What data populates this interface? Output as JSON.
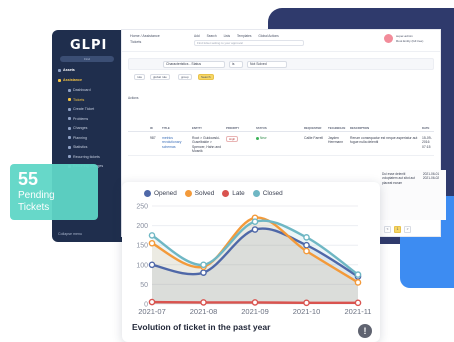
{
  "app": {
    "logo": "GLPI"
  },
  "sidebar": {
    "find_label": "Find",
    "items": [
      {
        "label": "Assets",
        "kind": "top"
      },
      {
        "label": "Assistance",
        "kind": "top",
        "active": true
      },
      {
        "label": "Dashboard",
        "kind": "sub"
      },
      {
        "label": "Tickets",
        "kind": "sub",
        "active": true
      },
      {
        "label": "Create Ticket",
        "kind": "sub"
      },
      {
        "label": "Problems",
        "kind": "sub"
      },
      {
        "label": "Changes",
        "kind": "sub"
      },
      {
        "label": "Planning",
        "kind": "sub"
      },
      {
        "label": "Statistics",
        "kind": "sub"
      },
      {
        "label": "Recurring tickets",
        "kind": "sub"
      },
      {
        "label": "Recurring changes",
        "kind": "sub"
      }
    ],
    "collapse_label": "Collapse menu"
  },
  "topbar": {
    "breadcrumb_1": "Home / Assistance",
    "breadcrumb_2": "Tickets",
    "actions": [
      "Add",
      "Search",
      "Lists",
      "Templates",
      "Global Actions"
    ],
    "search_placeholder": "Find ticket setting to your approval",
    "user_name": "super-admin",
    "user_entity": "Root Entity (full tree)"
  },
  "filters": {
    "field": "Characteristics - Status",
    "operator": "is",
    "value": "Not Solved"
  },
  "chips": [
    "rule",
    "global rule",
    "group",
    "Search"
  ],
  "table_tools": [
    "Actions"
  ],
  "table": {
    "headers": [
      "ID",
      "TITLE",
      "ENTITY",
      "PRIORITY",
      "STATUS",
      "REQUESTER",
      "TECHNICIAN",
      "DESCRIPTION",
      "DATE"
    ],
    "row": {
      "id": "987",
      "title": "metrics revolutionary schemas",
      "entity": "Root > Guidowski-Guselbakie > Spencer, Hahn and Mosnik",
      "priority": "High",
      "status": "New",
      "requester": "Callie Farrell",
      "technician": "Jayden Herrmann",
      "description": "Rerum consequatur est neque asperiatur aut fugue nulla deleniti",
      "date": "15-09-2016 07:15"
    },
    "partial_row_text": "Dui esse deleniti voluptatem aut sitot aut placeat earum",
    "partial_dates": [
      "2021-06-01",
      "2021-06-02"
    ]
  },
  "pager": {
    "pages": [
      "<",
      "1",
      ">"
    ],
    "selected": "1"
  },
  "pending_card": {
    "count": "55",
    "label": "Pending Tickets"
  },
  "chart_card": {
    "title": "Evolution of ticket in the past year",
    "info_icon": "info-icon"
  },
  "colors": {
    "navy": "#2f3a6c",
    "sidebar": "#1f2e4d",
    "accent_yellow": "#f7d766",
    "pending_teal": "#5fd6c7",
    "opened": "#4f68a8",
    "solved": "#f39a3a",
    "late": "#d9534f",
    "closed": "#6fb7c4"
  },
  "chart_data": {
    "type": "line",
    "title": "Evolution of ticket in the past year",
    "x": [
      "2021-07",
      "2021-08",
      "2021-09",
      "2021-10",
      "2021-11"
    ],
    "xlabel": "",
    "ylabel": "",
    "ylim": [
      0,
      250
    ],
    "yticks": [
      0,
      50,
      100,
      150,
      200,
      250
    ],
    "legend_position": "top",
    "series": [
      {
        "name": "Opened",
        "color": "#4f68a8",
        "values": [
          100,
          80,
          190,
          150,
          70
        ]
      },
      {
        "name": "Solved",
        "color": "#f39a3a",
        "values": [
          155,
          95,
          220,
          135,
          55
        ]
      },
      {
        "name": "Late",
        "color": "#d9534f",
        "values": [
          5,
          4,
          4,
          3,
          3
        ]
      },
      {
        "name": "Closed",
        "color": "#6fb7c4",
        "values": [
          175,
          100,
          210,
          170,
          75
        ]
      }
    ]
  }
}
